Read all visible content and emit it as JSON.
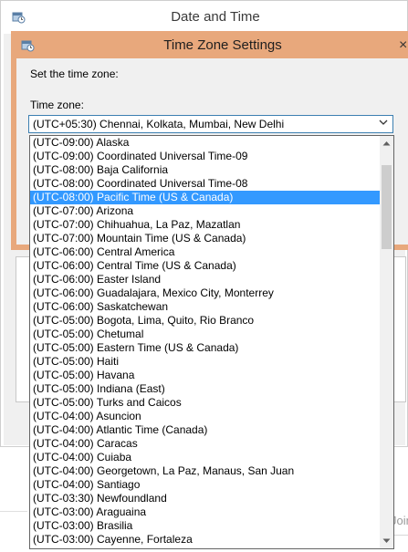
{
  "background_window": {
    "title": "Date and Time",
    "below_fragment_text": "Join n"
  },
  "dialog": {
    "title": "Time Zone Settings",
    "close_glyph": "×",
    "prompt": "Set the time zone:",
    "timezone_label": "Time zone:",
    "selected_value": "(UTC+05:30) Chennai, Kolkata, Mumbai, New Delhi"
  },
  "dropdown": {
    "items": [
      "(UTC-09:00) Alaska",
      "(UTC-09:00) Coordinated Universal Time-09",
      "(UTC-08:00) Baja California",
      "(UTC-08:00) Coordinated Universal Time-08",
      "(UTC-08:00) Pacific Time (US & Canada)",
      "(UTC-07:00) Arizona",
      "(UTC-07:00) Chihuahua, La Paz, Mazatlan",
      "(UTC-07:00) Mountain Time (US & Canada)",
      "(UTC-06:00) Central America",
      "(UTC-06:00) Central Time (US & Canada)",
      "(UTC-06:00) Easter Island",
      "(UTC-06:00) Guadalajara, Mexico City, Monterrey",
      "(UTC-06:00) Saskatchewan",
      "(UTC-05:00) Bogota, Lima, Quito, Rio Branco",
      "(UTC-05:00) Chetumal",
      "(UTC-05:00) Eastern Time (US & Canada)",
      "(UTC-05:00) Haiti",
      "(UTC-05:00) Havana",
      "(UTC-05:00) Indiana (East)",
      "(UTC-05:00) Turks and Caicos",
      "(UTC-04:00) Asuncion",
      "(UTC-04:00) Atlantic Time (Canada)",
      "(UTC-04:00) Caracas",
      "(UTC-04:00) Cuiaba",
      "(UTC-04:00) Georgetown, La Paz, Manaus, San Juan",
      "(UTC-04:00) Santiago",
      "(UTC-03:30) Newfoundland",
      "(UTC-03:00) Araguaina",
      "(UTC-03:00) Brasilia",
      "(UTC-03:00) Cayenne, Fortaleza"
    ],
    "highlighted_index": 4,
    "icons": {
      "scroll_up": "scroll-up-arrow-icon",
      "scroll_down": "scroll-down-arrow-icon"
    }
  },
  "colors": {
    "dialog_frame": "#e8a87c",
    "highlight": "#3399ff",
    "combo_border": "#3c7fb1"
  }
}
